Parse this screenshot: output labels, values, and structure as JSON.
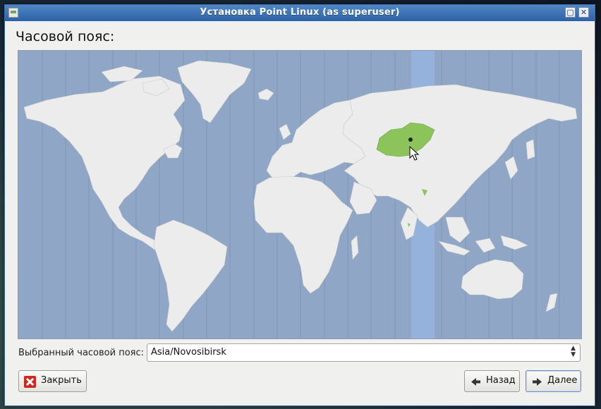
{
  "window": {
    "title": "Установка Point Linux (as superuser)",
    "minimize_glyph": "▢",
    "close_glyph": "✕"
  },
  "page": {
    "heading": "Часовой пояс:"
  },
  "map": {
    "selected_region": "Asia/Novosibirsk",
    "selected_color": "#8cc45b",
    "land_color": "#ececec",
    "ocean_color": "#8fa6c7",
    "highlight_band_color": "#95b2dc"
  },
  "timezone": {
    "label": "Выбранный часовой пояс:",
    "value": "Asia/Novosibirsk"
  },
  "buttons": {
    "close": "Закрыть",
    "back": "Назад",
    "next": "Далее"
  }
}
